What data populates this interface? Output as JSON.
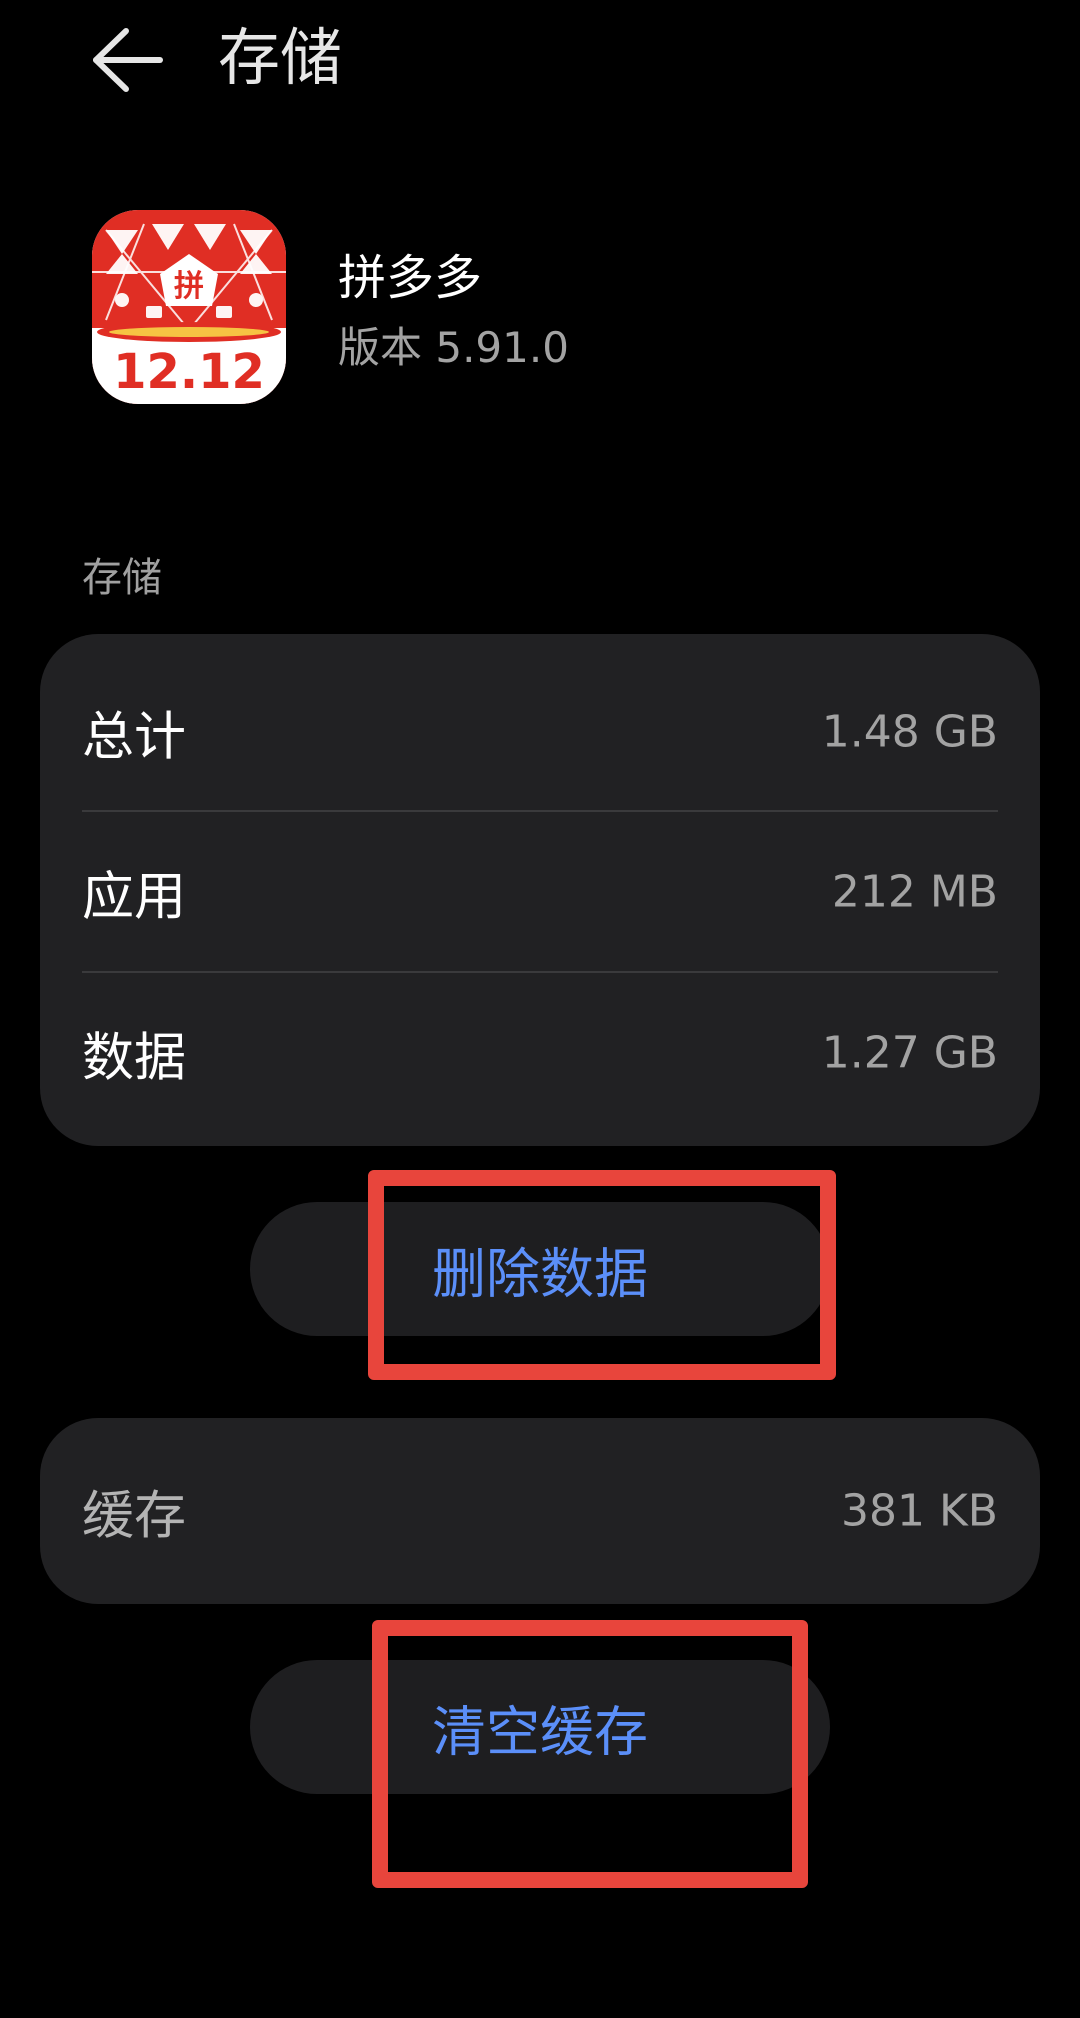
{
  "header": {
    "title": "存储"
  },
  "app": {
    "name": "拼多多",
    "version": "版本 5.91.0",
    "icon_text": "12.12",
    "icon_badge": "拼"
  },
  "storage_section": {
    "label": "存储",
    "rows": [
      {
        "label": "总计",
        "value": "1.48 GB"
      },
      {
        "label": "应用",
        "value": "212 MB"
      },
      {
        "label": "数据",
        "value": "1.27 GB"
      }
    ]
  },
  "buttons": {
    "delete_data": "删除数据",
    "clear_cache": "清空缓存"
  },
  "cache_section": {
    "label": "缓存",
    "value": "381 KB"
  },
  "colors": {
    "background": "#000000",
    "card": "#212123",
    "accent": "#5b8ff9",
    "highlight": "#e8453c",
    "icon_red": "#e02e24"
  },
  "icons": {
    "back": "arrow-left-icon",
    "app": "pinduoduo-app-icon"
  }
}
